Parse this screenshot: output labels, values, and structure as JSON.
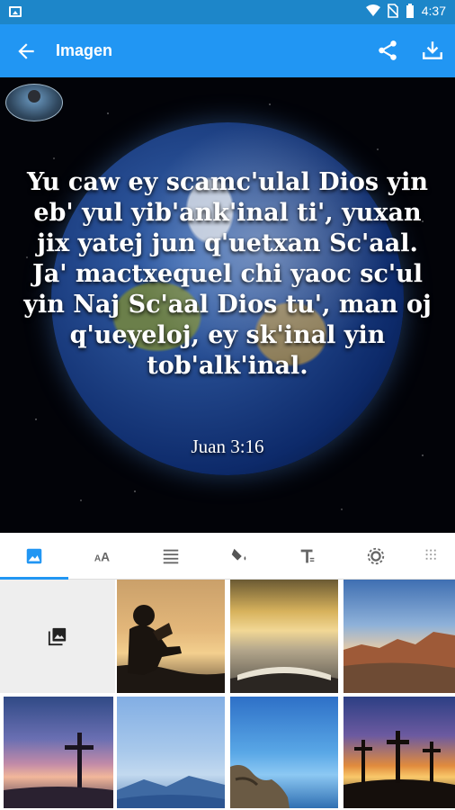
{
  "status_bar": {
    "time": "4:37"
  },
  "app_bar": {
    "title": "Imagen"
  },
  "canvas": {
    "verse": "Yu caw ey scamc'ulal Dios yin eb' yul yib'ank'inal ti', yuxan jix yatej jun q'uetxan Sc'aal. Ja' mactxequel chi yaoc sc'ul yin Naj Sc'aal Dios tu', man oj q'ueyeloj, ey sk'inal yin tob'alk'inal.",
    "reference": "Juan 3:16"
  },
  "tabs": [
    {
      "icon": "image-icon",
      "active": true
    },
    {
      "icon": "font-size-icon",
      "active": false
    },
    {
      "icon": "align-icon",
      "active": false
    },
    {
      "icon": "fill-color-icon",
      "active": false
    },
    {
      "icon": "text-format-icon",
      "active": false
    },
    {
      "icon": "brightness-icon",
      "active": false
    },
    {
      "icon": "texture-icon",
      "active": false
    }
  ],
  "backgrounds": [
    {
      "icon": "gallery-icon",
      "type": "gallery"
    },
    {
      "type": "photo",
      "subject": "silhouette reading at sunset"
    },
    {
      "type": "photo",
      "subject": "open book by lake"
    },
    {
      "type": "photo",
      "subject": "desert mountains"
    },
    {
      "type": "photo",
      "subject": "cross at dusk"
    },
    {
      "type": "photo",
      "subject": "misty mountains"
    },
    {
      "type": "photo",
      "subject": "rocky shoreline"
    },
    {
      "type": "photo",
      "subject": "three crosses at sunset"
    }
  ],
  "colors": {
    "primary": "#2196f3",
    "status": "#1d86c9",
    "accent_indicator": "#2196f3"
  }
}
